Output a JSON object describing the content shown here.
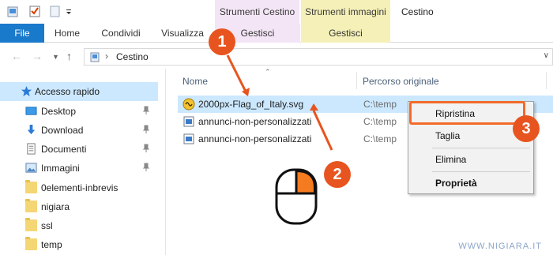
{
  "window": {
    "title": "Cestino",
    "context_tabs": [
      "Strumenti Cestino",
      "Strumenti immagini"
    ]
  },
  "ribbon": {
    "tabs": [
      "File",
      "Home",
      "Condividi",
      "Visualizza",
      "Gestisci",
      "Gestisci"
    ]
  },
  "address": {
    "path": "Cestino",
    "separator": "›"
  },
  "sidebar": {
    "items": [
      {
        "label": "Accesso rapido",
        "icon": "star-icon"
      },
      {
        "label": "Desktop",
        "icon": "desktop-icon",
        "pinned": true
      },
      {
        "label": "Download",
        "icon": "download-icon",
        "pinned": true
      },
      {
        "label": "Documenti",
        "icon": "documents-icon",
        "pinned": true
      },
      {
        "label": "Immagini",
        "icon": "pictures-icon",
        "pinned": true
      },
      {
        "label": "0elementi-inbrevis",
        "icon": "folder-icon"
      },
      {
        "label": "nigiara",
        "icon": "folder-icon"
      },
      {
        "label": "ssl",
        "icon": "folder-icon"
      },
      {
        "label": "temp",
        "icon": "folder-icon"
      }
    ]
  },
  "list": {
    "columns": [
      "Nome",
      "Percorso originale"
    ],
    "rows": [
      {
        "name": "2000px-Flag_of_Italy.svg",
        "path": "C:\\temp",
        "selected": true,
        "icon": "svg-file-icon"
      },
      {
        "name": "annunci-non-personalizzati",
        "path": "C:\\temp",
        "selected": false,
        "icon": "image-file-icon"
      },
      {
        "name": "annunci-non-personalizzati",
        "path": "C:\\temp",
        "selected": false,
        "icon": "image-file-icon"
      }
    ]
  },
  "context_menu": {
    "items": [
      "Ripristina",
      "Taglia",
      "Elimina",
      "Proprietà"
    ]
  },
  "annotations": {
    "steps": [
      "1",
      "2",
      "3"
    ],
    "accent": "#e8541f"
  },
  "watermark": "WWW.NIGIARA.IT",
  "colors": {
    "file_tab": "#1979ca",
    "selection": "#cce8ff",
    "ctx_cestino": "#f3e5f5",
    "ctx_immagini": "#f5f0b8"
  }
}
